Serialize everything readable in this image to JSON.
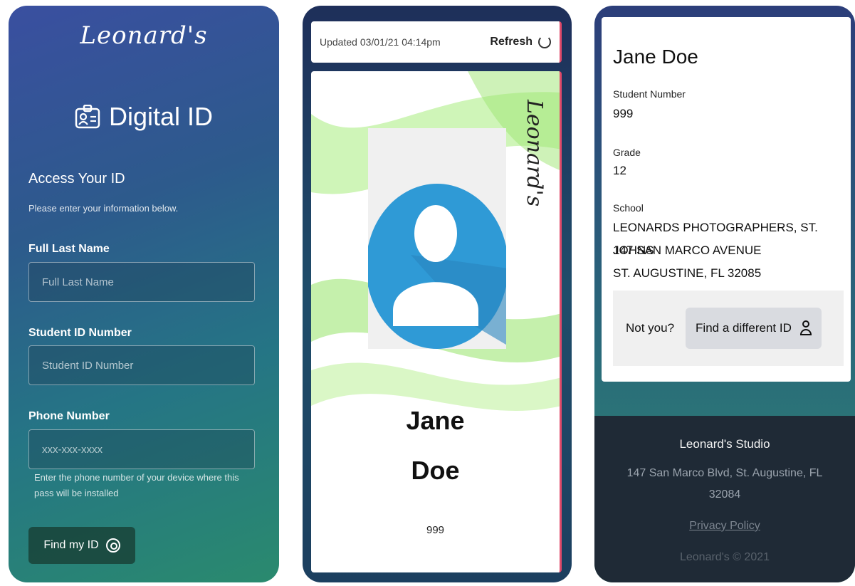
{
  "screen_access": {
    "logo": "Leonard's",
    "title": "Digital ID",
    "heading": "Access Your ID",
    "subheading": "Please enter your information below.",
    "last_name_label": "Full Last Name",
    "last_name_placeholder": "Full Last Name",
    "student_id_label": "Student ID Number",
    "student_id_placeholder": "Student ID Number",
    "phone_label": "Phone Number",
    "phone_placeholder": "xxx-xxx-xxxx",
    "phone_helper": "Enter the phone number of your device where this pass will be installed",
    "find_button": "Find my ID"
  },
  "screen_card": {
    "updated": "Updated 03/01/21 04:14pm",
    "refresh_label": "Refresh",
    "card_logo": "Leonard's",
    "first_name": "Jane",
    "last_name": "Doe",
    "student_number": "999",
    "colors": {
      "accent_stripe": "#e04a6a",
      "swirl": "#8be15a"
    }
  },
  "screen_details": {
    "name": "Jane Doe",
    "student_number_label": "Student Number",
    "student_number": "999",
    "grade_label": "Grade",
    "grade": "12",
    "school_label": "School",
    "school_line1": "LEONARDS PHOTOGRAPHERS, ST. JOHNS",
    "school_line2": "147 SAN MARCO AVENUE",
    "school_line3": "ST. AUGUSTINE, FL 32085",
    "not_you": "Not you?",
    "different_button": "Find a different ID",
    "footer_title": "Leonard's Studio",
    "footer_address": "147 San Marco Blvd, St. Augustine, FL 32084",
    "privacy_link": "Privacy Policy",
    "copyright": "Leonard's © 2021"
  }
}
